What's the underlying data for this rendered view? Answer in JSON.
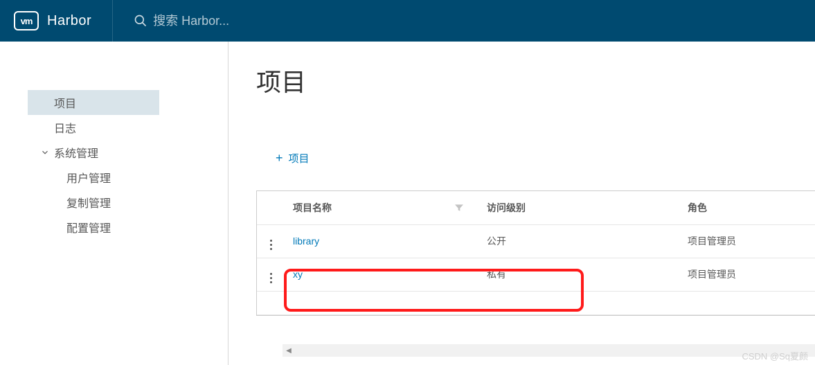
{
  "header": {
    "logo_abbr": "vm",
    "app_name": "Harbor",
    "search_placeholder": "搜索 Harbor..."
  },
  "sidebar": {
    "items": [
      {
        "label": "项目",
        "type": "item",
        "active": true
      },
      {
        "label": "日志",
        "type": "item",
        "active": false
      },
      {
        "label": "系统管理",
        "type": "group",
        "expanded": true
      },
      {
        "label": "用户管理",
        "type": "sub"
      },
      {
        "label": "复制管理",
        "type": "sub"
      },
      {
        "label": "配置管理",
        "type": "sub"
      }
    ]
  },
  "main": {
    "title": "项目",
    "add_button": "项目",
    "columns": {
      "name": "项目名称",
      "access": "访问级别",
      "role": "角色"
    },
    "rows": [
      {
        "name": "library",
        "access": "公开",
        "role": "项目管理员"
      },
      {
        "name": "xy",
        "access": "私有",
        "role": "项目管理员"
      }
    ]
  },
  "watermark": "CSDN @Sq夏颜"
}
